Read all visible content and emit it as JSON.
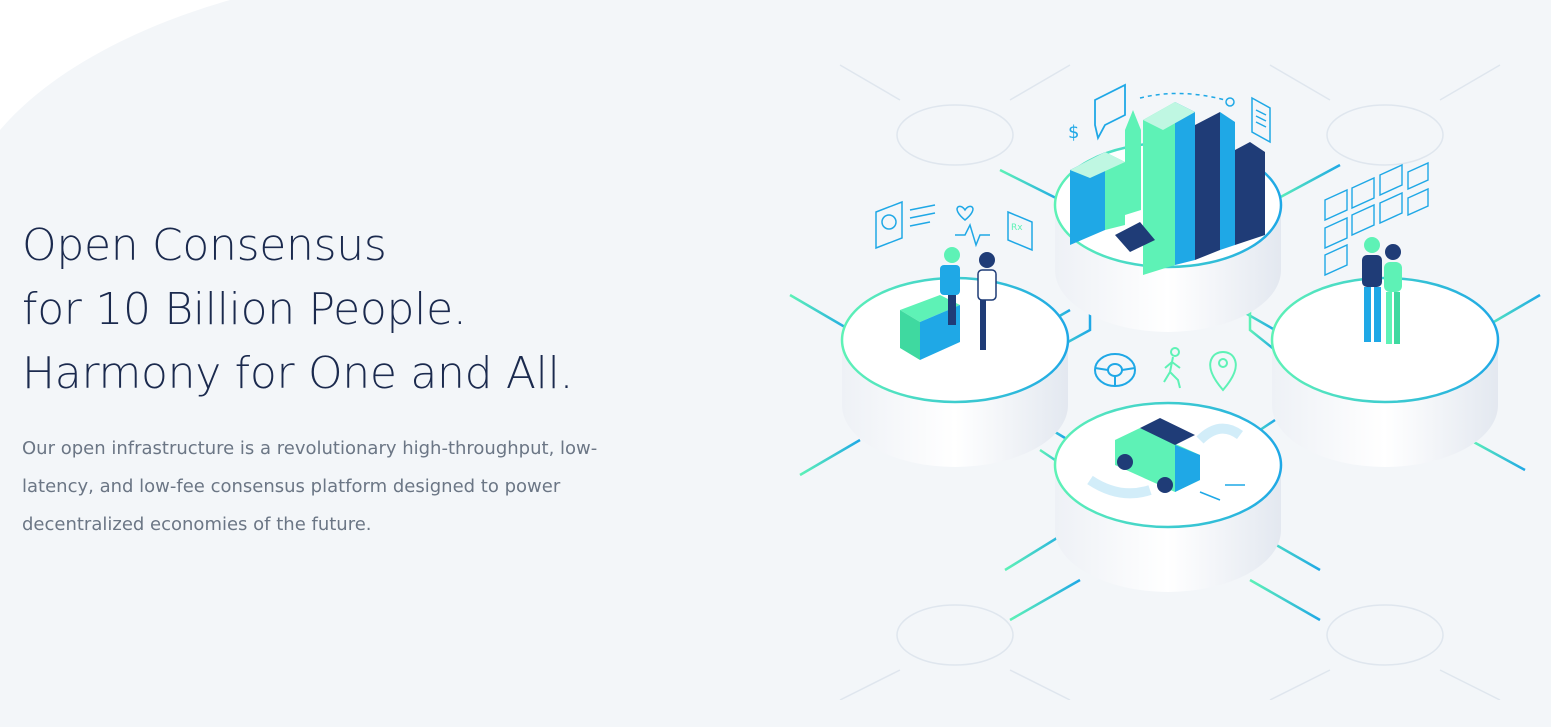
{
  "hero": {
    "headline_lines": [
      "Open Consensus",
      "for 10 Billion People.",
      "Harmony for One and All."
    ],
    "description": "Our open infrastructure is a revolutionary high-throughput, low-latency, and low-fee consensus platform designed to power decentralized economies of the future."
  },
  "illustration": {
    "icons": [
      "city-icon",
      "healthcare-icon",
      "media-icon",
      "transport-icon",
      "steering-wheel-icon",
      "walking-person-icon",
      "location-pin-icon",
      "dollar-icon",
      "chat-bubble-icon",
      "document-icon",
      "heart-icon",
      "prescription-icon"
    ],
    "colors": {
      "mint": "#5ef2b6",
      "blue": "#1fa8e6",
      "navy": "#1f3c77",
      "platform": "#ffffff",
      "headline": "#1b2a4e",
      "body_text": "#6b7685"
    }
  }
}
